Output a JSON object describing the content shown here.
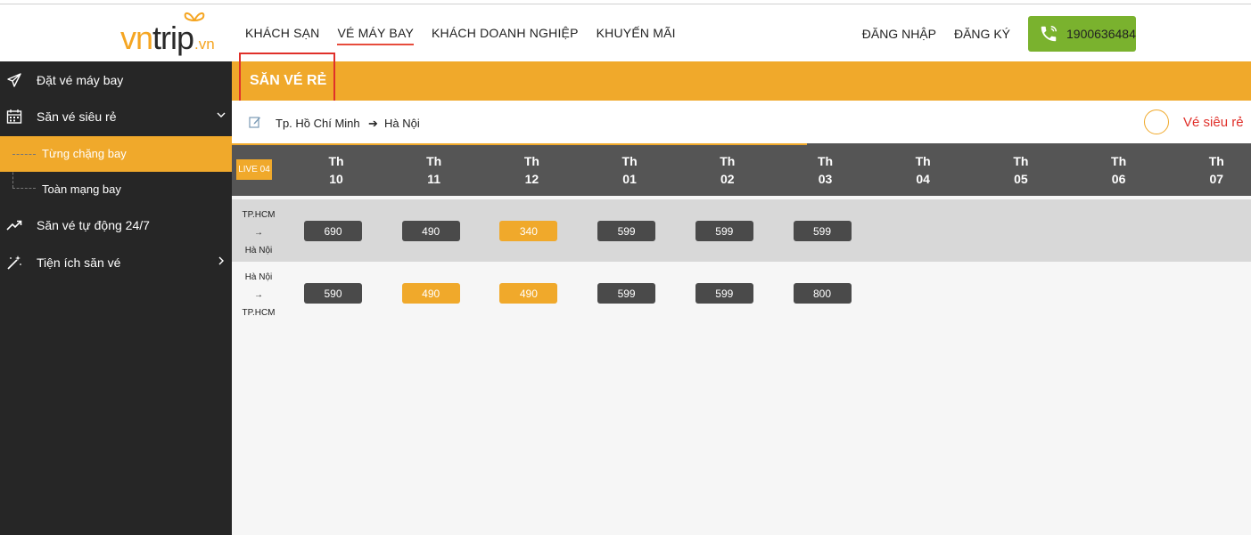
{
  "header": {
    "logo": {
      "vn": "vn",
      "trip": "trip",
      "domain": ".vn"
    },
    "nav": [
      {
        "label": "KHÁCH SẠN",
        "active": false
      },
      {
        "label": "VÉ MÁY BAY",
        "active": true
      },
      {
        "label": "KHÁCH DOANH NGHIỆP",
        "active": false
      },
      {
        "label": "KHUYẾN MÃI",
        "active": false
      }
    ],
    "login": "ĐĂNG NHẬP",
    "register": "ĐĂNG KÝ",
    "phone": "1900636484"
  },
  "sidebar": {
    "items": [
      {
        "label": "Đặt vé máy bay",
        "icon": "paper-plane-icon"
      },
      {
        "label": "Săn vé siêu rẻ",
        "icon": "calendar-icon",
        "chevron": "chevron-down-icon"
      },
      {
        "label": "Săn vé tự động 24/7",
        "icon": "trending-up-icon"
      },
      {
        "label": "Tiện ích săn vé",
        "icon": "magic-wand-icon",
        "chevron": "chevron-right-icon"
      }
    ],
    "subitems": [
      {
        "label": "Từng chặng bay",
        "active": true
      },
      {
        "label": "Toàn mạng bay",
        "active": false
      }
    ]
  },
  "main": {
    "banner_title": "SĂN VÉ RẺ",
    "route": {
      "from": "Tp. Hồ Chí Minh",
      "arrow": "➔",
      "to": "Hà Nội"
    },
    "cheap_label": "Vé siêu rẻ",
    "live_badge": "LIVE 04",
    "dates": [
      {
        "day": "Th",
        "num": "10"
      },
      {
        "day": "Th",
        "num": "11"
      },
      {
        "day": "Th",
        "num": "12"
      },
      {
        "day": "Th",
        "num": "01"
      },
      {
        "day": "Th",
        "num": "02"
      },
      {
        "day": "Th",
        "num": "03"
      },
      {
        "day": "Th",
        "num": "04"
      },
      {
        "day": "Th",
        "num": "05"
      },
      {
        "day": "Th",
        "num": "06"
      },
      {
        "day": "Th",
        "num": "07"
      }
    ],
    "rows": [
      {
        "from": "TP.HCM",
        "arrow": "→",
        "to": "Hà Nội",
        "fares": [
          {
            "value": "690",
            "cheap": false
          },
          {
            "value": "490",
            "cheap": false
          },
          {
            "value": "340",
            "cheap": true
          },
          {
            "value": "599",
            "cheap": false
          },
          {
            "value": "599",
            "cheap": false
          },
          {
            "value": "599",
            "cheap": false
          }
        ]
      },
      {
        "from": "Hà Nội",
        "arrow": "→",
        "to": "TP.HCM",
        "fares": [
          {
            "value": "590",
            "cheap": false
          },
          {
            "value": "490",
            "cheap": true
          },
          {
            "value": "490",
            "cheap": true
          },
          {
            "value": "599",
            "cheap": false
          },
          {
            "value": "599",
            "cheap": false
          },
          {
            "value": "800",
            "cheap": false
          }
        ]
      }
    ]
  },
  "colors": {
    "accent": "#f0a92b",
    "phone_green": "#7ab22e",
    "highlight_red": "#e0302a",
    "sidebar_bg": "#262626"
  }
}
